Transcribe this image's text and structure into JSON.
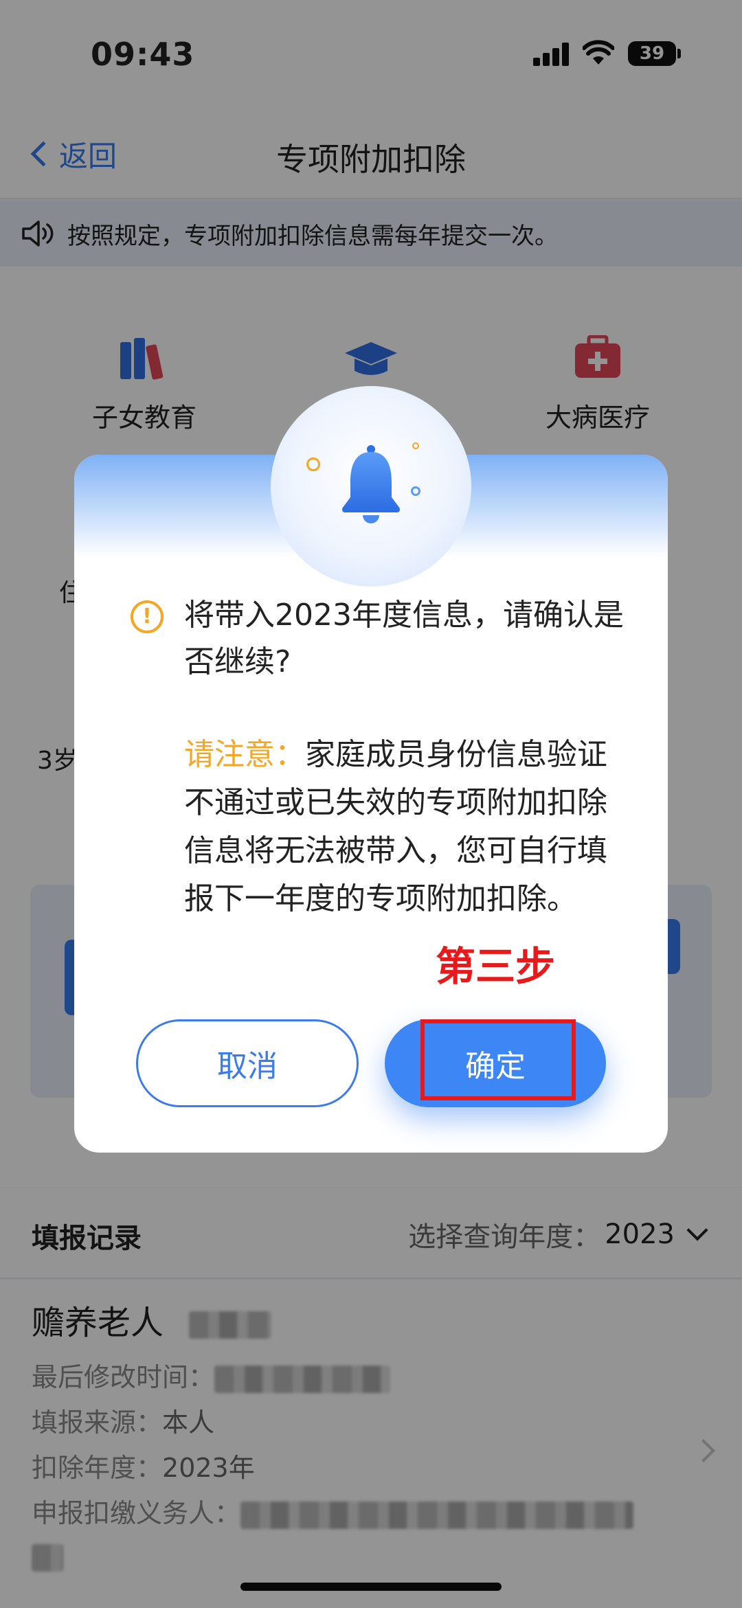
{
  "status_bar": {
    "time": "09:43",
    "battery": "39"
  },
  "nav": {
    "back_label": "返回",
    "title": "专项附加扣除"
  },
  "notice": {
    "text": "按照规定，专项附加扣除信息需每年提交一次。"
  },
  "categories": {
    "children_education": "子女教育",
    "serious_illness": "大病医疗",
    "partial_left": "住",
    "partial_infant": "3岁"
  },
  "records": {
    "title": "填报记录",
    "year_label": "选择查询年度：",
    "year_value": "2023",
    "item": {
      "name": "赡养老人",
      "modified_label": "最后修改时间：",
      "source_label": "填报来源：",
      "source_value": "本人",
      "year_label": "扣除年度：",
      "year_value": "2023年",
      "withholder_label": "申报扣缴义务人："
    }
  },
  "dialog": {
    "message": "将带入2023年度信息，请确认是否继续?",
    "note_label": "请注意：",
    "note_text": "家庭成员身份信息验证不通过或已失效的专项附加扣除信息将无法被带入，您可自行填报下一年度的专项附加扣除。",
    "cancel_label": "取消",
    "confirm_label": "确定"
  },
  "annotation": {
    "step_label": "第三步"
  },
  "colors": {
    "accent": "#3a7bf0",
    "warning": "#f5a623",
    "annotation_red": "#e8191b"
  }
}
